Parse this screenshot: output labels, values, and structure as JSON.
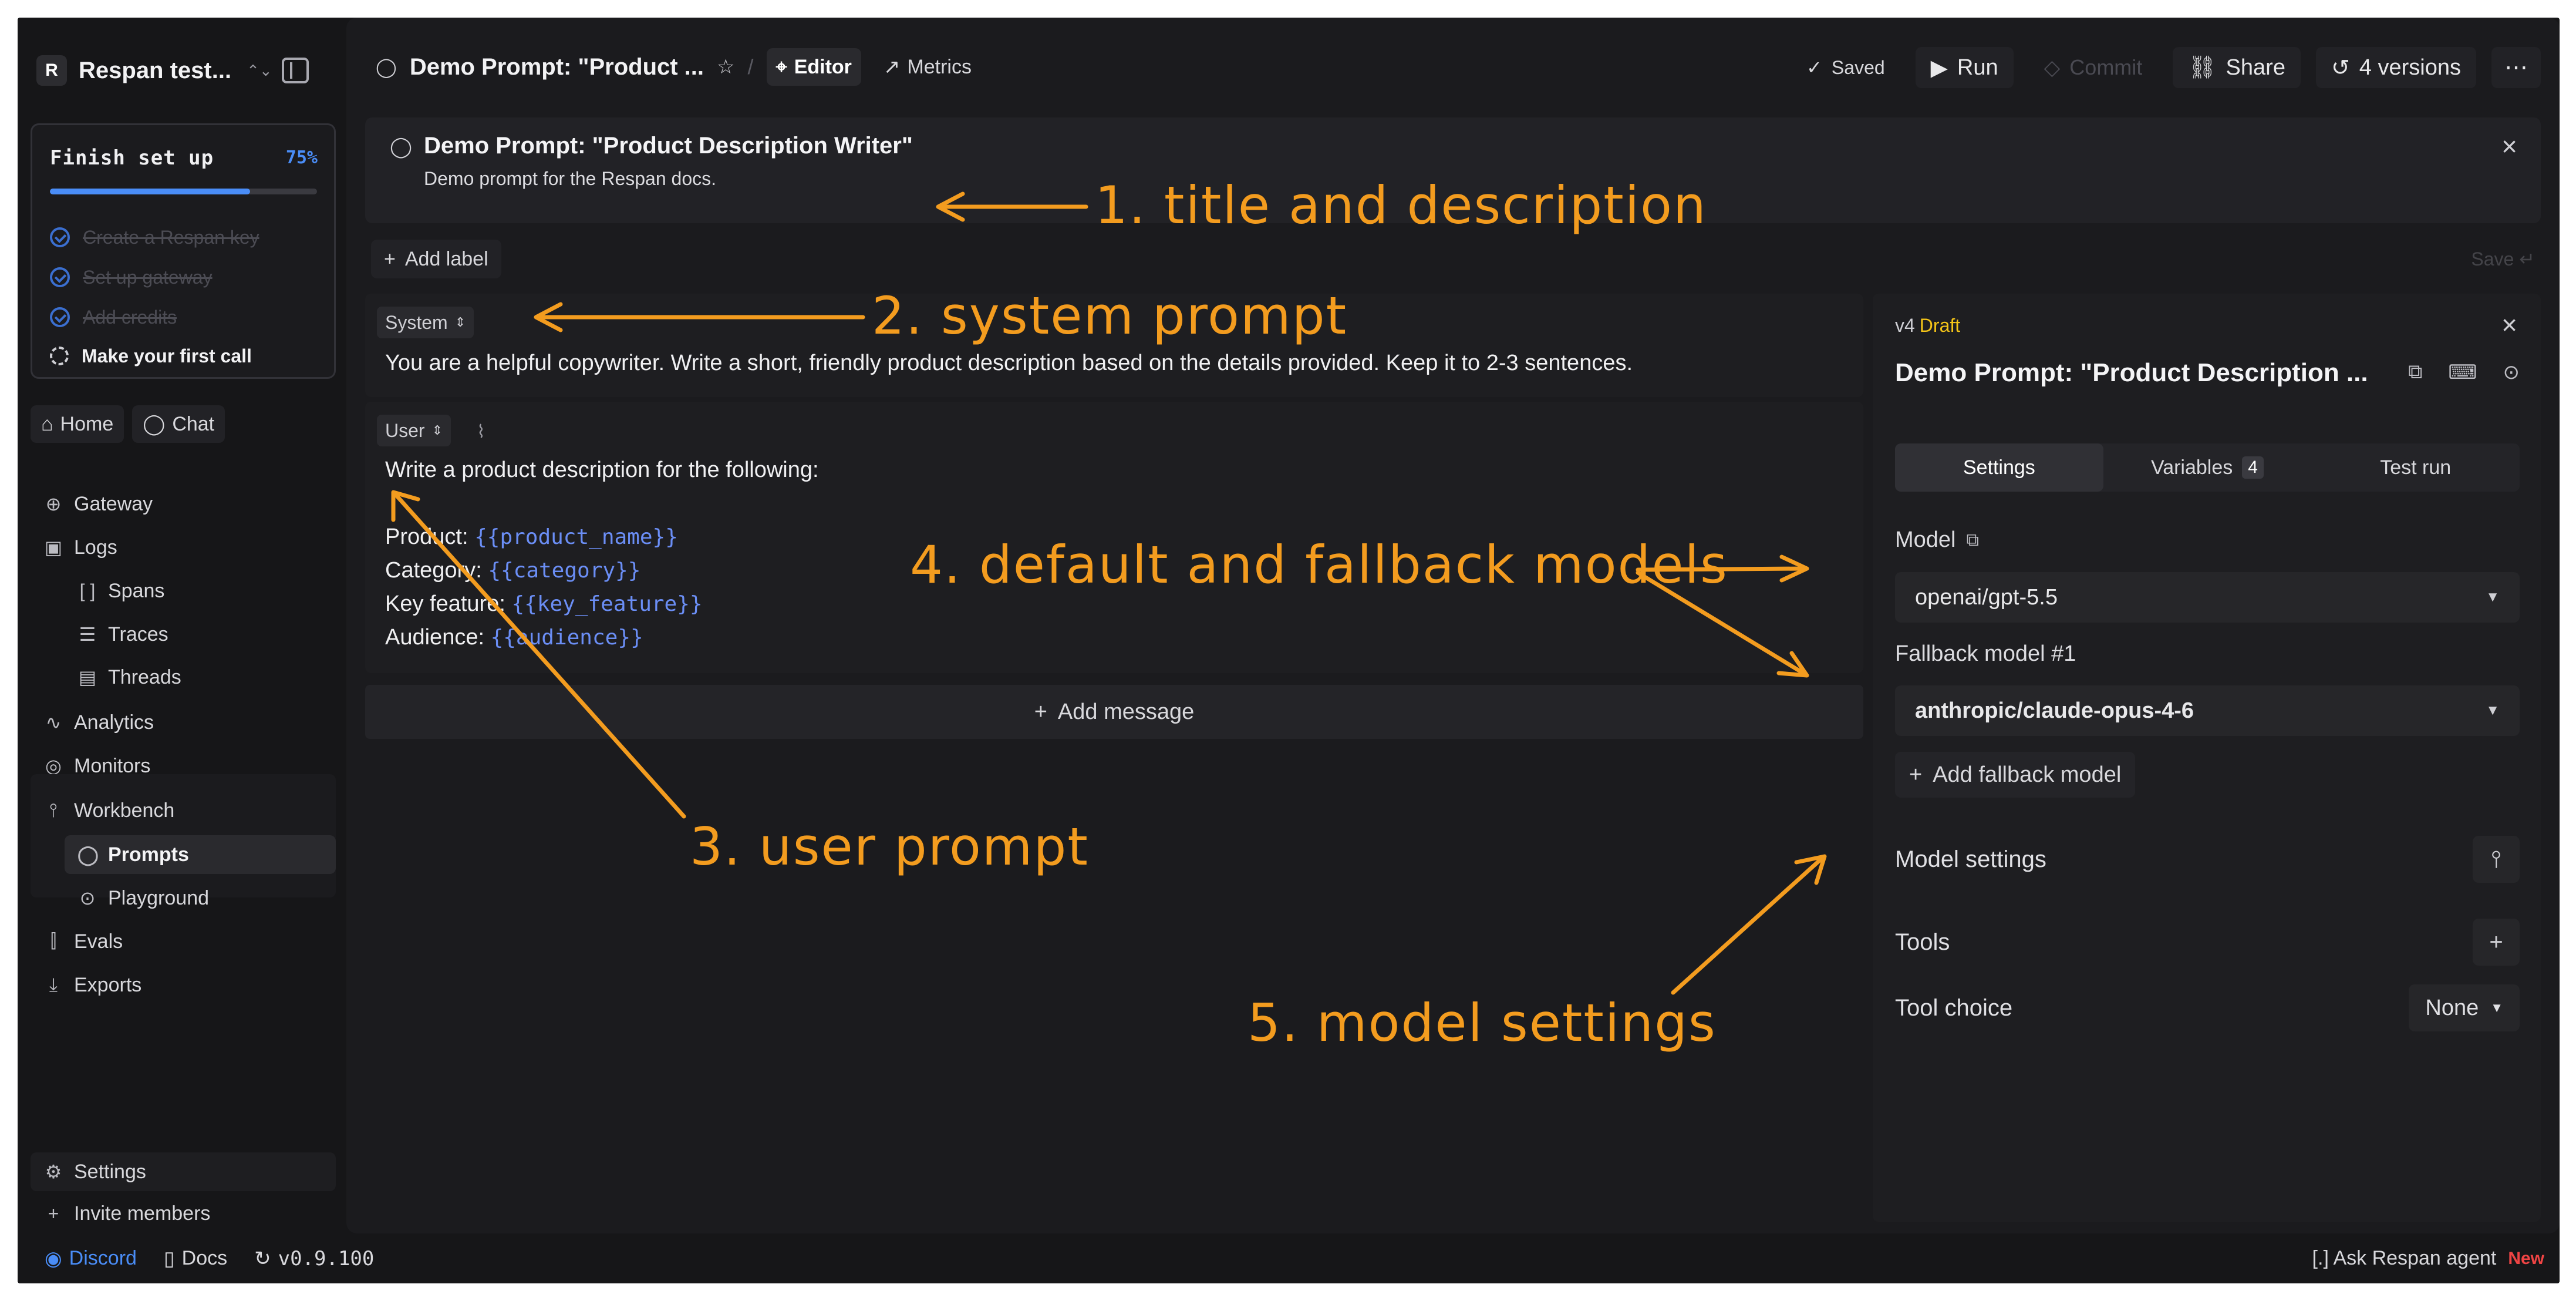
{
  "sidebar": {
    "workspace_initial": "R",
    "workspace_name": "Respan test...",
    "setup": {
      "title": "Finish set up",
      "percent": "75%",
      "progress": 0.75,
      "items": [
        {
          "label": "Create a Respan key",
          "done": true
        },
        {
          "label": "Set up gateway",
          "done": true
        },
        {
          "label": "Add credits",
          "done": true
        },
        {
          "label": "Make your first call",
          "done": false
        }
      ]
    },
    "home": "Home",
    "chat": "Chat",
    "nav": {
      "gateway": "Gateway",
      "logs": "Logs",
      "spans": "Spans",
      "traces": "Traces",
      "threads": "Threads",
      "analytics": "Analytics",
      "monitors": "Monitors",
      "workbench": "Workbench",
      "prompts": "Prompts",
      "playground": "Playground",
      "evals": "Evals",
      "exports": "Exports"
    },
    "settings": "Settings",
    "invite": "Invite members"
  },
  "statusbar": {
    "discord": "Discord",
    "docs": "Docs",
    "version": "v0.9.100",
    "agent": "Ask Respan agent",
    "new_badge": "New"
  },
  "topbar": {
    "title": "Demo Prompt: \"Product ...",
    "tab_editor": "Editor",
    "tab_metrics": "Metrics",
    "saved": "Saved",
    "run": "Run",
    "commit": "Commit",
    "share": "Share",
    "versions": "4 versions"
  },
  "prompt": {
    "title": "Demo Prompt: \"Product Description Writer\"",
    "description": "Demo prompt for the Respan docs.",
    "add_label": "Add label",
    "save_hint": "Save ↵"
  },
  "messages": {
    "system_role": "System",
    "system_text": "You are a helpful copywriter. Write a short, friendly product description based on the details provided. Keep it to 2-3 sentences.",
    "user_role": "User",
    "user_intro": "Write a product description for the following:",
    "user_lines": [
      {
        "label": "Product:",
        "var": "{{product_name}}"
      },
      {
        "label": "Category:",
        "var": "{{category}}"
      },
      {
        "label": "Key feature:",
        "var": "{{key_feature}}"
      },
      {
        "label": "Audience:",
        "var": "{{audience}}"
      }
    ],
    "add_message": "Add message"
  },
  "panel": {
    "version": "v4",
    "status": "Draft",
    "title": "Demo Prompt: \"Product Description ...",
    "tabs": {
      "settings": "Settings",
      "variables": "Variables",
      "variables_count": "4",
      "test_run": "Test run"
    },
    "model_label": "Model",
    "model_value": "openai/gpt-5.5",
    "fallback_label": "Fallback model #1",
    "fallback_value": "anthropic/claude-opus-4-6",
    "add_fallback": "Add fallback model",
    "model_settings": "Model settings",
    "tools": "Tools",
    "tool_choice": "Tool choice",
    "tool_choice_value": "None"
  },
  "annotations": {
    "a1": "1. title and description",
    "a2": "2. system prompt",
    "a3": "3. user prompt",
    "a4": "4. default and fallback models",
    "a5": "5. model settings"
  },
  "colors": {
    "accent": "#4a8df7",
    "draft": "#f5c518",
    "annotation": "#f39c1f",
    "new": "#ef4444"
  }
}
